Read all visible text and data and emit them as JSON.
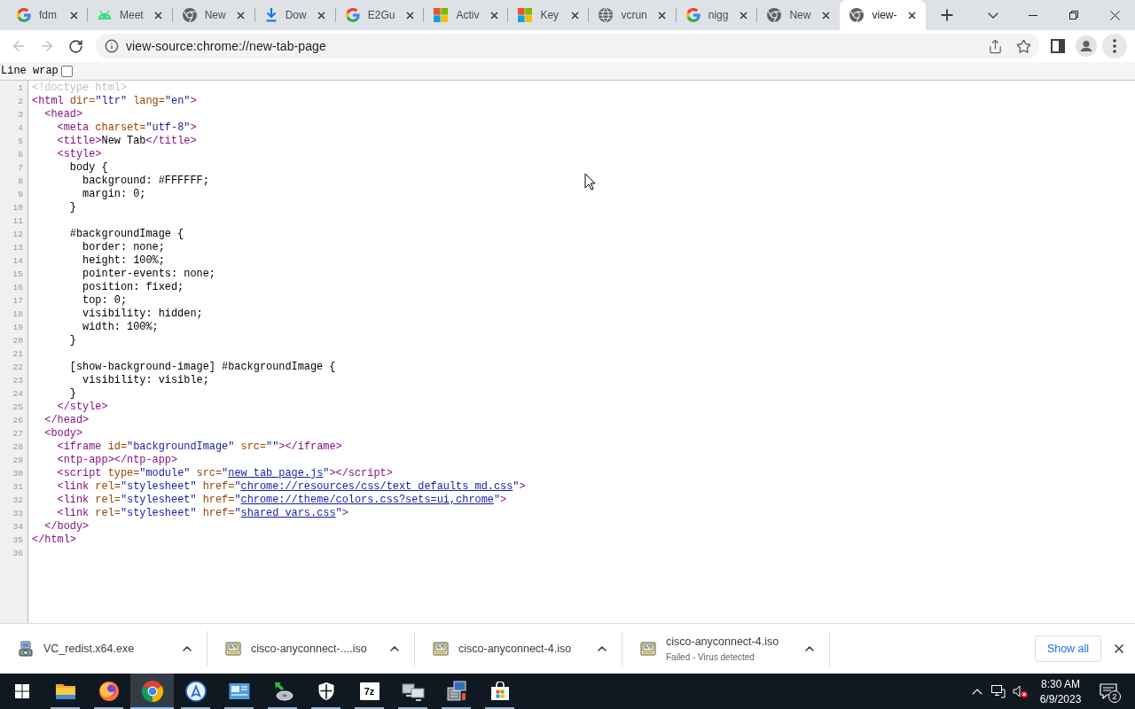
{
  "tabs": [
    {
      "title": "fdm",
      "kind": "google",
      "selected": false
    },
    {
      "title": "Meet",
      "kind": "android",
      "selected": false
    },
    {
      "title": "New",
      "kind": "chrome",
      "selected": false
    },
    {
      "title": "Dow",
      "kind": "download",
      "selected": false
    },
    {
      "title": "E2Gu",
      "kind": "google",
      "selected": false
    },
    {
      "title": "Activ",
      "kind": "microsoft",
      "selected": false
    },
    {
      "title": "Key",
      "kind": "microsoft",
      "selected": false
    },
    {
      "title": "vcrun",
      "kind": "globe",
      "selected": false
    },
    {
      "title": "nigg",
      "kind": "google",
      "selected": false
    },
    {
      "title": "New",
      "kind": "chrome",
      "selected": false
    },
    {
      "title": "view-",
      "kind": "chrome",
      "selected": true
    }
  ],
  "toolbar": {
    "back": {
      "disabled": true
    },
    "forward": {
      "disabled": true
    },
    "url": "view-source:chrome://new-tab-page"
  },
  "source_view": {
    "line_wrap": {
      "label": "Line wrap",
      "checked": false
    },
    "lines": [
      {
        "number": "1",
        "segments": [
          {
            "kind": "doctype",
            "text": "<!doctype html>"
          }
        ]
      },
      {
        "number": "2",
        "segments": [
          {
            "kind": "tag",
            "text": "<html "
          },
          {
            "kind": "attr",
            "text": "dir="
          },
          {
            "kind": "value",
            "text": "\"ltr\""
          },
          {
            "kind": "attr",
            "text": " lang="
          },
          {
            "kind": "value",
            "text": "\"en\""
          },
          {
            "kind": "tag",
            "text": ">"
          }
        ]
      },
      {
        "number": "3",
        "segments": [
          {
            "kind": "tag",
            "text": "  <head>"
          }
        ]
      },
      {
        "number": "4",
        "segments": [
          {
            "kind": "tag",
            "text": "    <meta "
          },
          {
            "kind": "attr",
            "text": "charset="
          },
          {
            "kind": "value",
            "text": "\"utf-8\""
          },
          {
            "kind": "tag",
            "text": ">"
          }
        ]
      },
      {
        "number": "5",
        "segments": [
          {
            "kind": "tag",
            "text": "    <title>"
          },
          {
            "kind": "text",
            "text": "New Tab"
          },
          {
            "kind": "tag",
            "text": "</title>"
          }
        ]
      },
      {
        "number": "6",
        "segments": [
          {
            "kind": "tag",
            "text": "    <style>"
          }
        ]
      },
      {
        "number": "7",
        "segments": [
          {
            "kind": "text",
            "text": "      body {"
          }
        ]
      },
      {
        "number": "8",
        "segments": [
          {
            "kind": "text",
            "text": "        background: #FFFFFF;"
          }
        ]
      },
      {
        "number": "9",
        "segments": [
          {
            "kind": "text",
            "text": "        margin: 0;"
          }
        ]
      },
      {
        "number": "10",
        "segments": [
          {
            "kind": "text",
            "text": "      }"
          }
        ]
      },
      {
        "number": "11"
      },
      {
        "number": "12",
        "segments": [
          {
            "kind": "text",
            "text": "      #backgroundImage {"
          }
        ]
      },
      {
        "number": "13",
        "segments": [
          {
            "kind": "text",
            "text": "        border: none;"
          }
        ]
      },
      {
        "number": "14",
        "segments": [
          {
            "kind": "text",
            "text": "        height: 100%;"
          }
        ]
      },
      {
        "number": "15",
        "segments": [
          {
            "kind": "text",
            "text": "        pointer-events: none;"
          }
        ]
      },
      {
        "number": "16",
        "segments": [
          {
            "kind": "text",
            "text": "        position: fixed;"
          }
        ]
      },
      {
        "number": "17",
        "segments": [
          {
            "kind": "text",
            "text": "        top: 0;"
          }
        ]
      },
      {
        "number": "18",
        "segments": [
          {
            "kind": "text",
            "text": "        visibility: hidden;"
          }
        ]
      },
      {
        "number": "19",
        "segments": [
          {
            "kind": "text",
            "text": "        width: 100%;"
          }
        ]
      },
      {
        "number": "20",
        "segments": [
          {
            "kind": "text",
            "text": "      }"
          }
        ]
      },
      {
        "number": "21"
      },
      {
        "number": "22",
        "segments": [
          {
            "kind": "text",
            "text": "      [show-background-image] #backgroundImage {"
          }
        ]
      },
      {
        "number": "23",
        "segments": [
          {
            "kind": "text",
            "text": "        visibility: visible;"
          }
        ]
      },
      {
        "number": "24",
        "segments": [
          {
            "kind": "text",
            "text": "      }"
          }
        ]
      },
      {
        "number": "25",
        "segments": [
          {
            "kind": "tag",
            "text": "    </style>"
          }
        ]
      },
      {
        "number": "26",
        "segments": [
          {
            "kind": "tag",
            "text": "  </head>"
          }
        ]
      },
      {
        "number": "27",
        "segments": [
          {
            "kind": "tag",
            "text": "  <body>"
          }
        ]
      },
      {
        "number": "28",
        "segments": [
          {
            "kind": "tag",
            "text": "    <iframe "
          },
          {
            "kind": "attr",
            "text": "id="
          },
          {
            "kind": "value",
            "text": "\"backgroundImage\""
          },
          {
            "kind": "attr",
            "text": " src="
          },
          {
            "kind": "value",
            "text": "\"\""
          },
          {
            "kind": "tag",
            "text": "></iframe>"
          }
        ]
      },
      {
        "number": "29",
        "segments": [
          {
            "kind": "tag",
            "text": "    <ntp-app></ntp-app>"
          }
        ]
      },
      {
        "number": "30",
        "segments": [
          {
            "kind": "tag",
            "text": "    <script "
          },
          {
            "kind": "attr",
            "text": "type="
          },
          {
            "kind": "value",
            "text": "\"module\""
          },
          {
            "kind": "attr",
            "text": " src="
          },
          {
            "kind": "value",
            "text": "\""
          },
          {
            "kind": "link",
            "text": "new_tab_page.js"
          },
          {
            "kind": "value",
            "text": "\""
          },
          {
            "kind": "tag",
            "text": "></script>"
          }
        ]
      },
      {
        "number": "31",
        "segments": [
          {
            "kind": "tag",
            "text": "    <link "
          },
          {
            "kind": "attr",
            "text": "rel="
          },
          {
            "kind": "value",
            "text": "\"stylesheet\""
          },
          {
            "kind": "attr",
            "text": " href="
          },
          {
            "kind": "value",
            "text": "\""
          },
          {
            "kind": "link",
            "text": "chrome://resources/css/text_defaults_md.css"
          },
          {
            "kind": "value",
            "text": "\""
          },
          {
            "kind": "tag",
            "text": ">"
          }
        ]
      },
      {
        "number": "32",
        "segments": [
          {
            "kind": "tag",
            "text": "    <link "
          },
          {
            "kind": "attr",
            "text": "rel="
          },
          {
            "kind": "value",
            "text": "\"stylesheet\""
          },
          {
            "kind": "attr",
            "text": " href="
          },
          {
            "kind": "value",
            "text": "\""
          },
          {
            "kind": "link",
            "text": "chrome://theme/colors.css?sets=ui,chrome"
          },
          {
            "kind": "value",
            "text": "\""
          },
          {
            "kind": "tag",
            "text": ">"
          }
        ]
      },
      {
        "number": "33",
        "segments": [
          {
            "kind": "tag",
            "text": "    <link "
          },
          {
            "kind": "attr",
            "text": "rel="
          },
          {
            "kind": "value",
            "text": "\"stylesheet\""
          },
          {
            "kind": "attr",
            "text": " href="
          },
          {
            "kind": "value",
            "text": "\""
          },
          {
            "kind": "link",
            "text": "shared_vars.css"
          },
          {
            "kind": "value",
            "text": "\""
          },
          {
            "kind": "tag",
            "text": ">"
          }
        ]
      },
      {
        "number": "34",
        "segments": [
          {
            "kind": "tag",
            "text": "  </body>"
          }
        ]
      },
      {
        "number": "35",
        "segments": [
          {
            "kind": "tag",
            "text": "</html>"
          }
        ]
      },
      {
        "number": "36"
      }
    ]
  },
  "downloads": {
    "items": [
      {
        "name": "VC_redist.x64.exe",
        "kind": "exe"
      },
      {
        "name": "cisco-anyconnect-....iso",
        "kind": "iso"
      },
      {
        "name": "cisco-anyconnect-4.iso",
        "kind": "iso"
      },
      {
        "name": "cisco-anyconnect-4.iso",
        "kind": "iso",
        "status": "Failed - Virus detected"
      }
    ],
    "show_all": "Show all"
  },
  "taskbar": {
    "apps": [
      {
        "kind": "folder",
        "running": true,
        "active": false
      },
      {
        "kind": "fox",
        "running": true,
        "active": false
      },
      {
        "kind": "chrome",
        "running": true,
        "active": true
      },
      {
        "kind": "compass",
        "running": true,
        "active": false
      },
      {
        "kind": "panel",
        "running": true,
        "active": false
      },
      {
        "kind": "installer",
        "running": true,
        "active": false
      },
      {
        "kind": "shield",
        "running": true,
        "active": false
      },
      {
        "kind": "archive",
        "label": "7z",
        "running": true,
        "active": false
      },
      {
        "kind": "network",
        "running": true,
        "active": false
      },
      {
        "kind": "setup",
        "running": true,
        "active": false
      },
      {
        "kind": "store",
        "running": true,
        "active": false
      }
    ],
    "time": "8:30 AM",
    "date": "6/9/2023",
    "notifications": "2"
  }
}
